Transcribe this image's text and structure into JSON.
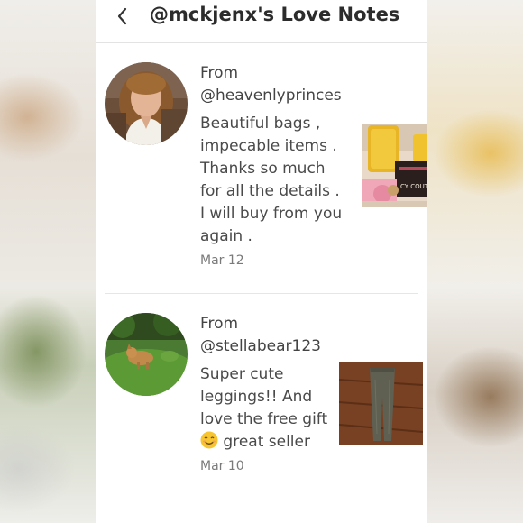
{
  "header": {
    "title": "@mckjenx's Love Notes"
  },
  "notes": [
    {
      "from_label": "From",
      "handle": "@heavenlyprinces",
      "message": "Beautiful bags , impecable items . Thanks so much for all the details . I will buy from you again .",
      "date": "Mar 12",
      "thumb_caption": "CY COUT"
    },
    {
      "from_label": "From",
      "handle": "@stellabear123",
      "message_before": "Super cute leggings!! And love the free gift",
      "emoji": "smiling-face-emoji",
      "message_after": "great seller",
      "date": "Mar 10"
    }
  ]
}
